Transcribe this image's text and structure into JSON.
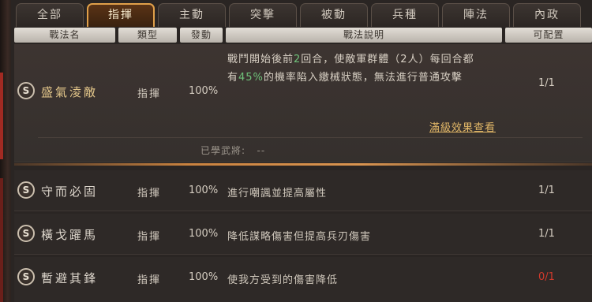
{
  "tabs": [
    {
      "label": "全部"
    },
    {
      "label": "指揮"
    },
    {
      "label": "主動"
    },
    {
      "label": "突擊"
    },
    {
      "label": "被動"
    },
    {
      "label": "兵種"
    },
    {
      "label": "陣法"
    },
    {
      "label": "內政"
    }
  ],
  "active_tab": "指揮",
  "columns": {
    "name": "戰法名",
    "type": "類型",
    "trigger": "發動",
    "description": "戰法說明",
    "configurable": "可配置"
  },
  "selected_tactic": {
    "badge": "S",
    "name": "盛氣淩敵",
    "type": "指揮",
    "trigger": "100%",
    "desc_line1_a": "戰鬥開始後前",
    "desc_line1_num": "2",
    "desc_line1_b": "回合，使敵軍群體（2人）每回合都",
    "desc_line2_a": "有",
    "desc_line2_pct": "45%",
    "desc_line2_b": "的機率陷入繳械狀態，無法進行普通攻擊",
    "configurable": "1/1",
    "full_level_link": "滿級效果查看",
    "learned_label": "已學武將:",
    "learned_value": "--"
  },
  "tactics": [
    {
      "badge": "S",
      "name": "守而必固",
      "type": "指揮",
      "trigger": "100%",
      "description": "進行嘲諷並提高屬性",
      "configurable": "1/1"
    },
    {
      "badge": "S",
      "name": "橫戈躍馬",
      "type": "指揮",
      "trigger": "100%",
      "description": "降低謀略傷害但提高兵刃傷害",
      "configurable": "1/1"
    },
    {
      "badge": "S",
      "name": "暫避其鋒",
      "type": "指揮",
      "trigger": "100%",
      "description": "使我方受到的傷害降低",
      "configurable": "0/1"
    }
  ],
  "colors": {
    "active_tab_border": "#e0a04a",
    "highlight_green": "#6fc27a",
    "link_gold": "#e2b767",
    "unavailable_red": "#d23a2c"
  }
}
